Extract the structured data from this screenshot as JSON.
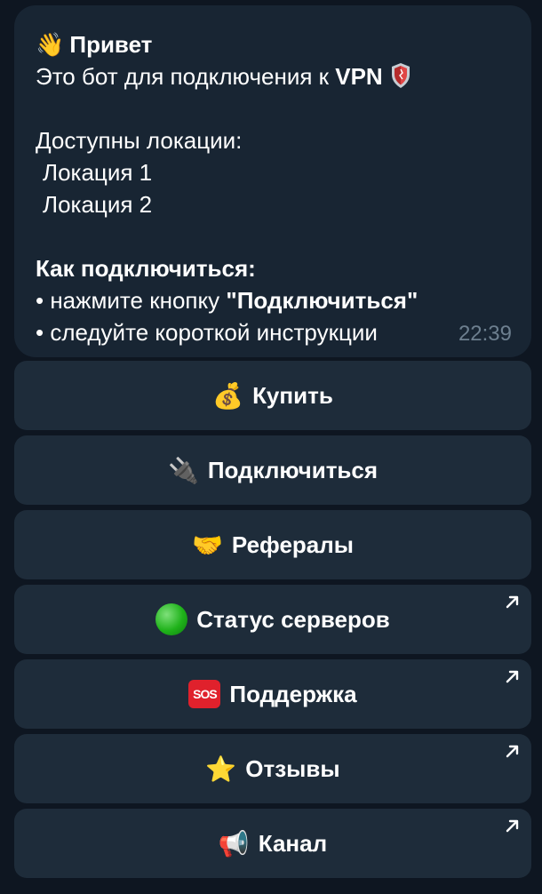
{
  "message": {
    "greeting_icon": "waving-hand-icon",
    "greeting": "Привет",
    "intro_prefix": "Это бот для подключения к ",
    "intro_vpn": "VPN",
    "intro_icon": "shield-icon",
    "locations_header": "Доступны локации:",
    "locations": [
      "Локация 1",
      "Локация 2"
    ],
    "howto_header": "Как подключиться:",
    "step1_prefix": "• нажмите кнопку ",
    "step1_bold": "\"Подключиться\"",
    "step2": "• следуйте короткой инструкции",
    "time": "22:39"
  },
  "buttons": [
    {
      "label": "Купить",
      "icon": "money-bag-icon",
      "emoji": "💰",
      "external": false
    },
    {
      "label": "Подключиться",
      "icon": "plug-icon",
      "emoji": "🔌",
      "external": false
    },
    {
      "label": "Рефералы",
      "icon": "handshake-icon",
      "emoji": "🤝",
      "external": false
    },
    {
      "label": "Статус серверов",
      "icon": "green-circle-icon",
      "emoji": "",
      "external": true
    },
    {
      "label": "Поддержка",
      "icon": "sos-icon",
      "emoji": "SOS",
      "external": true
    },
    {
      "label": "Отзывы",
      "icon": "star-icon",
      "emoji": "⭐",
      "external": true
    },
    {
      "label": "Канал",
      "icon": "megaphone-icon",
      "emoji": "📢",
      "external": true
    }
  ],
  "colors": {
    "background": "#0e1621",
    "bubble": "#182533",
    "button": "#1e2c3a",
    "timestamp": "#6d7f8f"
  }
}
